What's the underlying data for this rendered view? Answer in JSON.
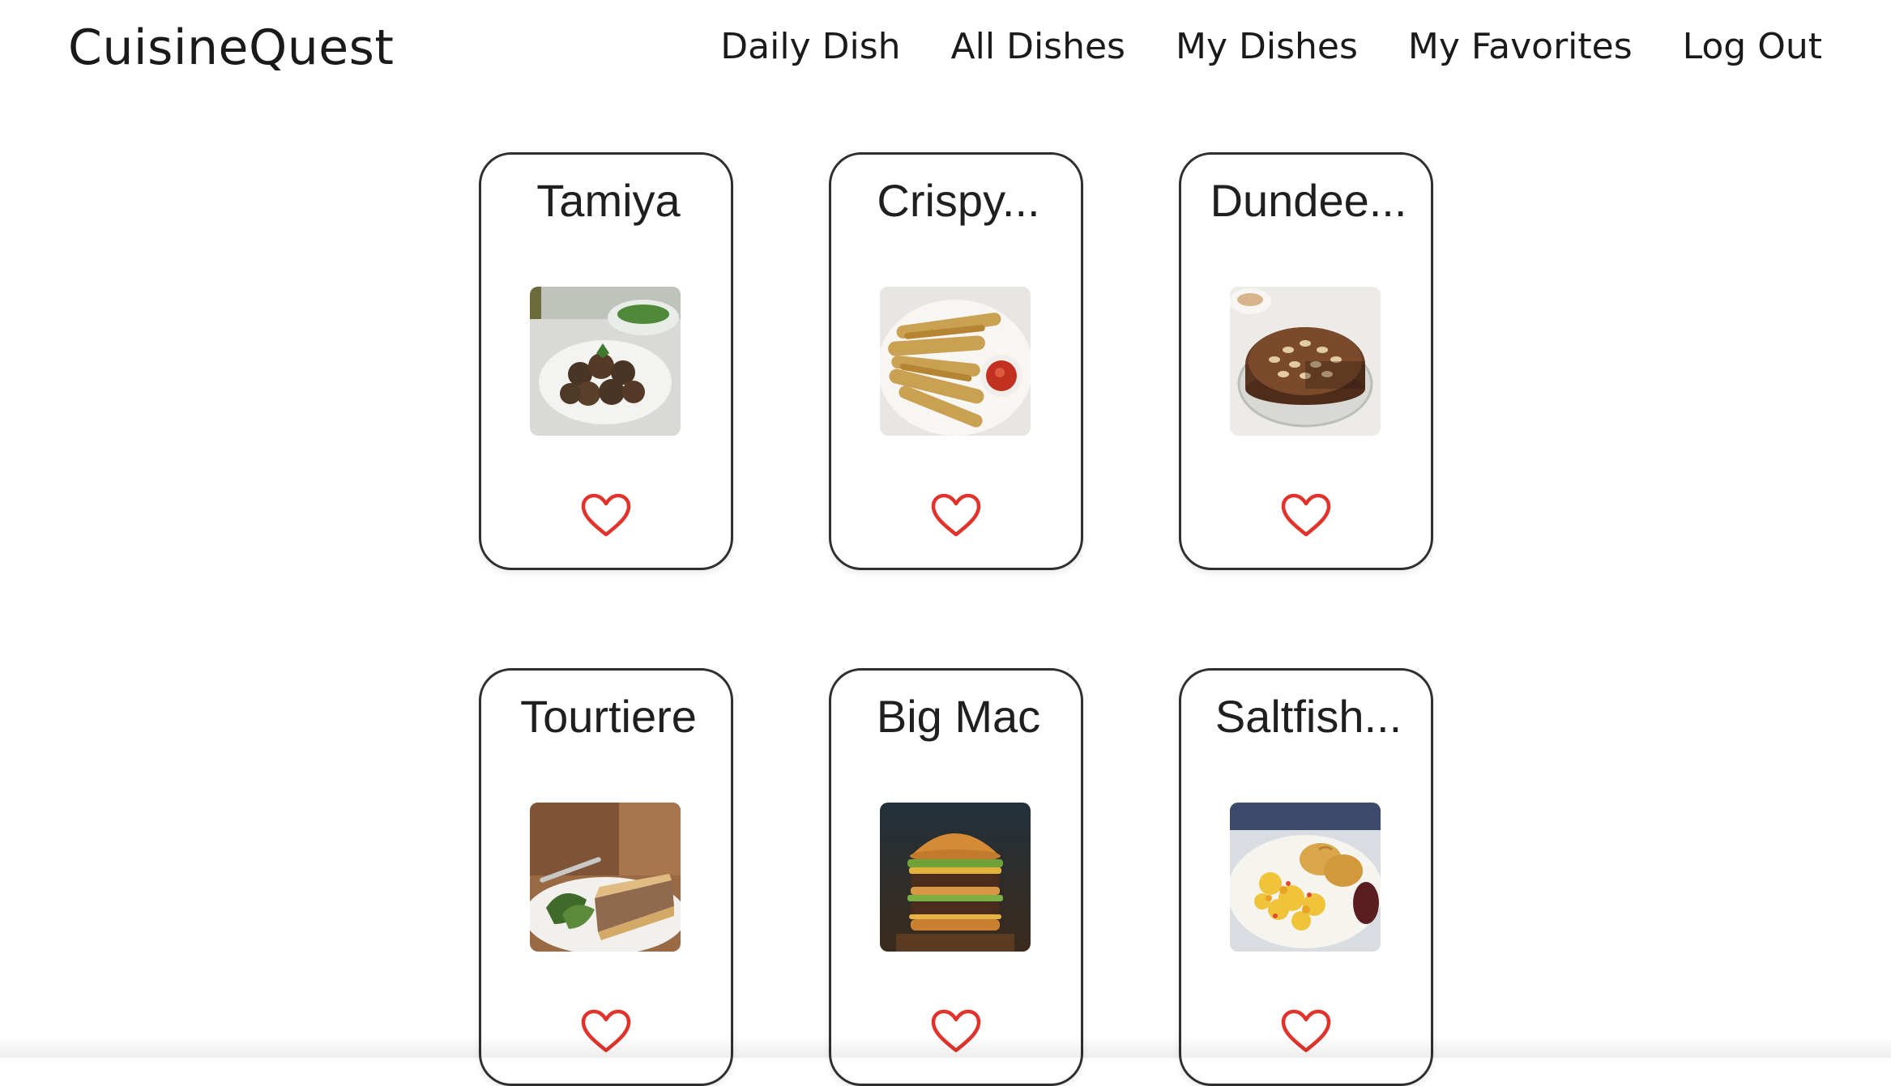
{
  "header": {
    "brand": "CuisineQuest",
    "nav": [
      {
        "label": "Daily Dish"
      },
      {
        "label": "All Dishes"
      },
      {
        "label": "My Dishes"
      },
      {
        "label": "My Favorites"
      },
      {
        "label": "Log Out"
      }
    ]
  },
  "dishes": [
    {
      "name": "Tamiya",
      "favorited": false
    },
    {
      "name": "Crispy...",
      "favorited": false
    },
    {
      "name": "Dundee...",
      "favorited": false
    },
    {
      "name": "Tourtiere",
      "favorited": false
    },
    {
      "name": "Big Mac",
      "favorited": false
    },
    {
      "name": "Saltfish...",
      "favorited": false
    }
  ],
  "colors": {
    "heart": "#e0332b",
    "card_border": "#2f2f2f"
  },
  "icons": {
    "favorite": "heart-outline-icon"
  }
}
